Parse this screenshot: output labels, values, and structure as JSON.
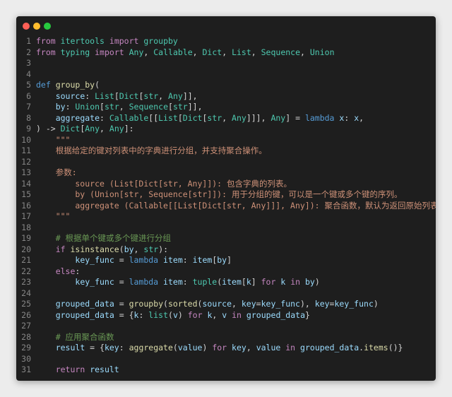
{
  "window": {
    "controls": [
      "close",
      "minimize",
      "maximize"
    ]
  },
  "editor": {
    "language": "python",
    "lines": [
      {
        "n": "1",
        "tokens": [
          [
            "kw",
            "from"
          ],
          [
            "pl",
            " "
          ],
          [
            "ty",
            "itertools"
          ],
          [
            "pl",
            " "
          ],
          [
            "kw",
            "import"
          ],
          [
            "pl",
            " "
          ],
          [
            "ty",
            "groupby"
          ]
        ]
      },
      {
        "n": "2",
        "tokens": [
          [
            "kw",
            "from"
          ],
          [
            "pl",
            " "
          ],
          [
            "ty",
            "typing"
          ],
          [
            "pl",
            " "
          ],
          [
            "kw",
            "import"
          ],
          [
            "pl",
            " "
          ],
          [
            "ty",
            "Any"
          ],
          [
            "pl",
            ", "
          ],
          [
            "ty",
            "Callable"
          ],
          [
            "pl",
            ", "
          ],
          [
            "ty",
            "Dict"
          ],
          [
            "pl",
            ", "
          ],
          [
            "ty",
            "List"
          ],
          [
            "pl",
            ", "
          ],
          [
            "ty",
            "Sequence"
          ],
          [
            "pl",
            ", "
          ],
          [
            "ty",
            "Union"
          ]
        ]
      },
      {
        "n": "3",
        "tokens": []
      },
      {
        "n": "4",
        "tokens": []
      },
      {
        "n": "5",
        "tokens": [
          [
            "df",
            "def"
          ],
          [
            "pl",
            " "
          ],
          [
            "fn",
            "group_by"
          ],
          [
            "pl",
            "("
          ]
        ]
      },
      {
        "n": "6",
        "tokens": [
          [
            "pl",
            "    "
          ],
          [
            "va",
            "source"
          ],
          [
            "pl",
            ": "
          ],
          [
            "ty",
            "List"
          ],
          [
            "pl",
            "["
          ],
          [
            "ty",
            "Dict"
          ],
          [
            "pl",
            "["
          ],
          [
            "ty",
            "str"
          ],
          [
            "pl",
            ", "
          ],
          [
            "ty",
            "Any"
          ],
          [
            "pl",
            "]],"
          ]
        ]
      },
      {
        "n": "7",
        "tokens": [
          [
            "pl",
            "    "
          ],
          [
            "va",
            "by"
          ],
          [
            "pl",
            ": "
          ],
          [
            "ty",
            "Union"
          ],
          [
            "pl",
            "["
          ],
          [
            "ty",
            "str"
          ],
          [
            "pl",
            ", "
          ],
          [
            "ty",
            "Sequence"
          ],
          [
            "pl",
            "["
          ],
          [
            "ty",
            "str"
          ],
          [
            "pl",
            "]],"
          ]
        ]
      },
      {
        "n": "8",
        "tokens": [
          [
            "pl",
            "    "
          ],
          [
            "va",
            "aggregate"
          ],
          [
            "pl",
            ": "
          ],
          [
            "ty",
            "Callable"
          ],
          [
            "pl",
            "[["
          ],
          [
            "ty",
            "List"
          ],
          [
            "pl",
            "["
          ],
          [
            "ty",
            "Dict"
          ],
          [
            "pl",
            "["
          ],
          [
            "ty",
            "str"
          ],
          [
            "pl",
            ", "
          ],
          [
            "ty",
            "Any"
          ],
          [
            "pl",
            "]]], "
          ],
          [
            "ty",
            "Any"
          ],
          [
            "pl",
            "] = "
          ],
          [
            "df",
            "lambda"
          ],
          [
            "pl",
            " "
          ],
          [
            "va",
            "x"
          ],
          [
            "pl",
            ": "
          ],
          [
            "va",
            "x"
          ],
          [
            "pl",
            ","
          ]
        ]
      },
      {
        "n": "9",
        "tokens": [
          [
            "pl",
            ") -> "
          ],
          [
            "ty",
            "Dict"
          ],
          [
            "pl",
            "["
          ],
          [
            "ty",
            "Any"
          ],
          [
            "pl",
            ", "
          ],
          [
            "ty",
            "Any"
          ],
          [
            "pl",
            "]:"
          ]
        ]
      },
      {
        "n": "10",
        "tokens": [
          [
            "str",
            "    \"\"\""
          ]
        ]
      },
      {
        "n": "11",
        "tokens": [
          [
            "str",
            "    根据给定的键对列表中的字典进行分组，并支持聚合操作。"
          ]
        ]
      },
      {
        "n": "12",
        "tokens": []
      },
      {
        "n": "13",
        "tokens": [
          [
            "str",
            "    参数:"
          ]
        ]
      },
      {
        "n": "14",
        "tokens": [
          [
            "str",
            "        source (List[Dict[str, Any]]): 包含字典的列表。"
          ]
        ]
      },
      {
        "n": "15",
        "tokens": [
          [
            "str",
            "        by (Union[str, Sequence[str]]): 用于分组的键，可以是一个键或多个键的序列。"
          ]
        ]
      },
      {
        "n": "16",
        "tokens": [
          [
            "str",
            "        aggregate (Callable[[List[Dict[str, Any]]], Any]): 聚合函数，默认为返回原始列表。"
          ]
        ]
      },
      {
        "n": "17",
        "tokens": [
          [
            "str",
            "    \"\"\""
          ]
        ]
      },
      {
        "n": "18",
        "tokens": []
      },
      {
        "n": "19",
        "tokens": [
          [
            "pl",
            "    "
          ],
          [
            "cm",
            "# 根据单个键或多个键进行分组"
          ]
        ]
      },
      {
        "n": "20",
        "tokens": [
          [
            "pl",
            "    "
          ],
          [
            "kw",
            "if"
          ],
          [
            "pl",
            " "
          ],
          [
            "fn",
            "isinstance"
          ],
          [
            "pl",
            "("
          ],
          [
            "va",
            "by"
          ],
          [
            "pl",
            ", "
          ],
          [
            "ty",
            "str"
          ],
          [
            "pl",
            "):"
          ]
        ]
      },
      {
        "n": "21",
        "tokens": [
          [
            "pl",
            "        "
          ],
          [
            "va",
            "key_func"
          ],
          [
            "pl",
            " = "
          ],
          [
            "df",
            "lambda"
          ],
          [
            "pl",
            " "
          ],
          [
            "va",
            "item"
          ],
          [
            "pl",
            ": "
          ],
          [
            "va",
            "item"
          ],
          [
            "pl",
            "["
          ],
          [
            "va",
            "by"
          ],
          [
            "pl",
            "]"
          ]
        ]
      },
      {
        "n": "22",
        "tokens": [
          [
            "pl",
            "    "
          ],
          [
            "kw",
            "else"
          ],
          [
            "pl",
            ":"
          ]
        ]
      },
      {
        "n": "23",
        "tokens": [
          [
            "pl",
            "        "
          ],
          [
            "va",
            "key_func"
          ],
          [
            "pl",
            " = "
          ],
          [
            "df",
            "lambda"
          ],
          [
            "pl",
            " "
          ],
          [
            "va",
            "item"
          ],
          [
            "pl",
            ": "
          ],
          [
            "ty",
            "tuple"
          ],
          [
            "pl",
            "("
          ],
          [
            "va",
            "item"
          ],
          [
            "pl",
            "["
          ],
          [
            "va",
            "k"
          ],
          [
            "pl",
            "] "
          ],
          [
            "kw",
            "for"
          ],
          [
            "pl",
            " "
          ],
          [
            "va",
            "k"
          ],
          [
            "pl",
            " "
          ],
          [
            "kw",
            "in"
          ],
          [
            "pl",
            " "
          ],
          [
            "va",
            "by"
          ],
          [
            "pl",
            ")"
          ]
        ]
      },
      {
        "n": "24",
        "tokens": []
      },
      {
        "n": "25",
        "tokens": [
          [
            "pl",
            "    "
          ],
          [
            "va",
            "grouped_data"
          ],
          [
            "pl",
            " = "
          ],
          [
            "fn",
            "groupby"
          ],
          [
            "pl",
            "("
          ],
          [
            "fn",
            "sorted"
          ],
          [
            "pl",
            "("
          ],
          [
            "va",
            "source"
          ],
          [
            "pl",
            ", "
          ],
          [
            "va",
            "key"
          ],
          [
            "pl",
            "="
          ],
          [
            "va",
            "key_func"
          ],
          [
            "pl",
            "), "
          ],
          [
            "va",
            "key"
          ],
          [
            "pl",
            "="
          ],
          [
            "va",
            "key_func"
          ],
          [
            "pl",
            ")"
          ]
        ]
      },
      {
        "n": "26",
        "tokens": [
          [
            "pl",
            "    "
          ],
          [
            "va",
            "grouped_data"
          ],
          [
            "pl",
            " = {"
          ],
          [
            "va",
            "k"
          ],
          [
            "pl",
            ": "
          ],
          [
            "ty",
            "list"
          ],
          [
            "pl",
            "("
          ],
          [
            "va",
            "v"
          ],
          [
            "pl",
            ") "
          ],
          [
            "kw",
            "for"
          ],
          [
            "pl",
            " "
          ],
          [
            "va",
            "k"
          ],
          [
            "pl",
            ", "
          ],
          [
            "va",
            "v"
          ],
          [
            "pl",
            " "
          ],
          [
            "kw",
            "in"
          ],
          [
            "pl",
            " "
          ],
          [
            "va",
            "grouped_data"
          ],
          [
            "pl",
            "}"
          ]
        ]
      },
      {
        "n": "27",
        "tokens": []
      },
      {
        "n": "28",
        "tokens": [
          [
            "pl",
            "    "
          ],
          [
            "cm",
            "# 应用聚合函数"
          ]
        ]
      },
      {
        "n": "29",
        "tokens": [
          [
            "pl",
            "    "
          ],
          [
            "va",
            "result"
          ],
          [
            "pl",
            " = {"
          ],
          [
            "va",
            "key"
          ],
          [
            "pl",
            ": "
          ],
          [
            "fn",
            "aggregate"
          ],
          [
            "pl",
            "("
          ],
          [
            "va",
            "value"
          ],
          [
            "pl",
            ") "
          ],
          [
            "kw",
            "for"
          ],
          [
            "pl",
            " "
          ],
          [
            "va",
            "key"
          ],
          [
            "pl",
            ", "
          ],
          [
            "va",
            "value"
          ],
          [
            "pl",
            " "
          ],
          [
            "kw",
            "in"
          ],
          [
            "pl",
            " "
          ],
          [
            "va",
            "grouped_data"
          ],
          [
            "pl",
            "."
          ],
          [
            "fn",
            "items"
          ],
          [
            "pl",
            "()}"
          ]
        ]
      },
      {
        "n": "30",
        "tokens": []
      },
      {
        "n": "31",
        "tokens": [
          [
            "pl",
            "    "
          ],
          [
            "kw",
            "return"
          ],
          [
            "pl",
            " "
          ],
          [
            "va",
            "result"
          ]
        ]
      }
    ]
  }
}
